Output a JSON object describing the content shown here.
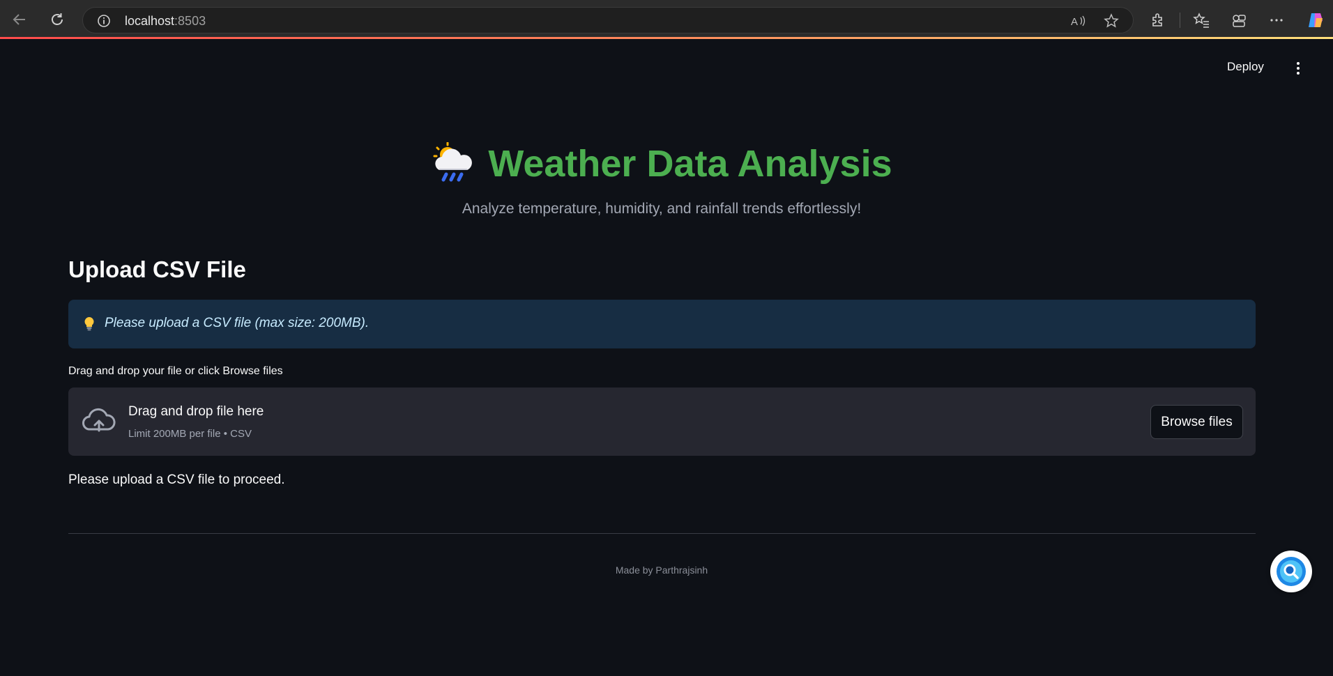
{
  "browser": {
    "url_host": "localhost",
    "url_port": ":8503"
  },
  "header": {
    "deploy_label": "Deploy"
  },
  "main": {
    "title": "Weather Data Analysis",
    "subtitle": "Analyze temperature, humidity, and rainfall trends effortlessly!",
    "section_title": "Upload CSV File",
    "info_message": "Please upload a CSV file (max size: 200MB).",
    "uploader_label": "Drag and drop your file or click Browse files",
    "dropzone_title": "Drag and drop file here",
    "dropzone_limit": "Limit 200MB per file • CSV",
    "browse_label": "Browse files",
    "status_message": "Please upload a CSV file to proceed.",
    "footer": "Made by Parthrajsinh"
  },
  "icons": {
    "title_emoji": "cloud-rain-sun-icon",
    "info": "lightbulb-icon",
    "dropzone": "cloud-upload-icon"
  },
  "colors": {
    "title": "#4caf50",
    "background": "#0e1117",
    "info_bg": "#172d43",
    "dropzone_bg": "#262730"
  }
}
